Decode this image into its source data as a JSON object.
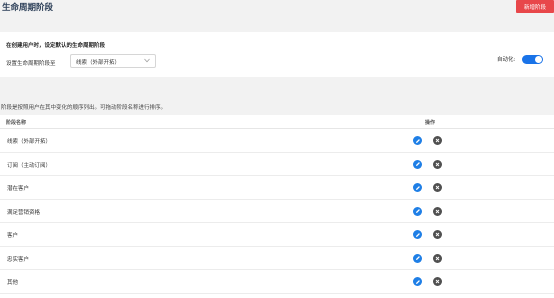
{
  "header": {
    "title": "生命周期阶段",
    "new_button_label": "新增阶段"
  },
  "settings_panel": {
    "title": "在创建用户时，设定默认的生命周期阶段",
    "set_label": "设置生命周期阶段至",
    "selected_stage": "线索（外部开拓）",
    "auto_label": "自动化:",
    "auto_enabled": true
  },
  "description": "阶段是按照用户在其中变化的顺序列出。可拖动阶段名称进行排序。",
  "table": {
    "columns": {
      "name": "阶段名称",
      "ops": "操作"
    },
    "rows": [
      {
        "name": "线索（外部开拓）"
      },
      {
        "name": "订阅（主动订阅）"
      },
      {
        "name": "潜在客户"
      },
      {
        "name": "满足营销资格"
      },
      {
        "name": "客户"
      },
      {
        "name": "忠实客户"
      },
      {
        "name": "其他"
      }
    ]
  },
  "colors": {
    "accent": "#1f7fe6",
    "new_button": "#e8474a",
    "delete_icon": "#505050"
  },
  "icons": {
    "edit": "pencil-icon",
    "delete": "close-icon",
    "dropdown": "chevron-down-icon"
  }
}
